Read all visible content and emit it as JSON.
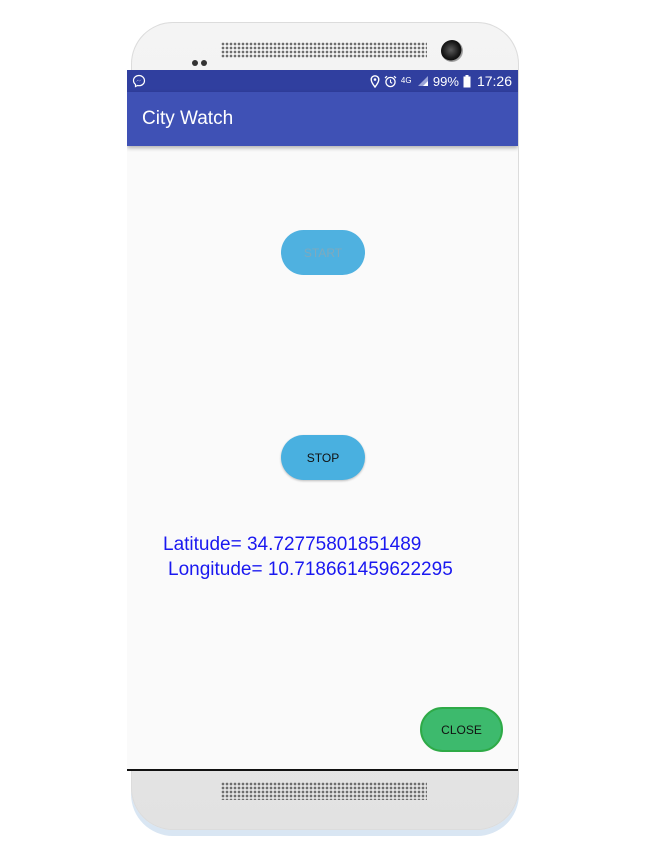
{
  "status_bar": {
    "battery": "99%",
    "time": "17:26",
    "network": "4G",
    "icons": [
      "messenger-icon",
      "location-icon",
      "alarm-icon",
      "network-4g-icon",
      "signal-icon",
      "battery-icon"
    ]
  },
  "app_bar": {
    "title": "City Watch"
  },
  "buttons": {
    "start": "START",
    "stop": "STOP",
    "close": "CLOSE"
  },
  "location": {
    "latitude_text": "Latitude= 34.72775801851489",
    "longitude_text": "Longitude= 10.718661459622295"
  },
  "colors": {
    "status_bar": "#303f9f",
    "app_bar": "#3f51b5",
    "start_button": "#4fb1e0",
    "stop_button": "#49b0e0",
    "close_button": "#3dba6d",
    "coordinate_text": "#1a18f0"
  }
}
